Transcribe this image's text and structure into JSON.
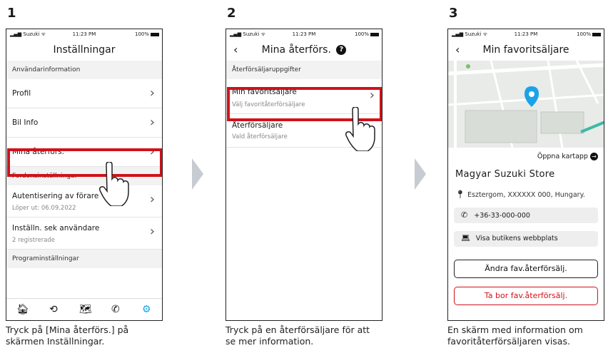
{
  "steps": [
    {
      "number": "1",
      "caption_line1": "Tryck på [Mina återförs.] på",
      "caption_line2": "skärmen Inställningar.",
      "status": {
        "carrier": "Suzuki",
        "time": "11:23 PM",
        "battery": "100%"
      },
      "title": "Inställningar",
      "sections": {
        "user_info": "Användarinformation",
        "vehicle_settings": "Fordonsinställningar",
        "program_settings": "Programinställningar"
      },
      "rows": {
        "profile": "Profil",
        "car_info": "Bil Info",
        "my_dealers": "Mina återförs.",
        "driver_auth": "Autentisering av förare",
        "driver_auth_sub": "Löper ut: 06.09.2022",
        "secondary_users": "Inställn. sek användare",
        "secondary_users_sub": "2 registrerade"
      },
      "tabs": [
        "home-icon",
        "history-icon",
        "map-icon",
        "phone-icon",
        "settings-icon"
      ]
    },
    {
      "number": "2",
      "caption_line1": "Tryck på en återförsäljare för att",
      "caption_line2": "se mer information.",
      "status": {
        "carrier": "Suzuki",
        "time": "11:23 PM",
        "battery": "100%"
      },
      "title": "Mina återförs.",
      "section": "Återförsäljaruppgifter",
      "rows": {
        "favorite": "Min favoritsäljare",
        "favorite_sub": "Välj favoritåterförsäljare",
        "dealer": "Återförsäljare",
        "dealer_sub": "Vald återförsäljare"
      }
    },
    {
      "number": "3",
      "caption_line1": "En skärm med information om",
      "caption_line2": "favoritåterförsäljaren visas.",
      "status": {
        "carrier": "Suzuki",
        "time": "11:23 PM",
        "battery": "100%"
      },
      "title": "Min favoritsäljare",
      "open_map": "Öppna kartapp",
      "store_name": "Magyar Suzuki Store",
      "address": "Esztergom, XXXXXX 000, Hungary.",
      "phone": "+36-33-000-000",
      "website": "Visa butikens webbplats",
      "change_button": "Ändra fav.återförsälj.",
      "remove_button": "Ta bor fav.återförsälj."
    }
  ],
  "colors": {
    "highlight": "#d0121b",
    "accent": "#1aa3e8",
    "arrow": "#c7ccd3"
  }
}
